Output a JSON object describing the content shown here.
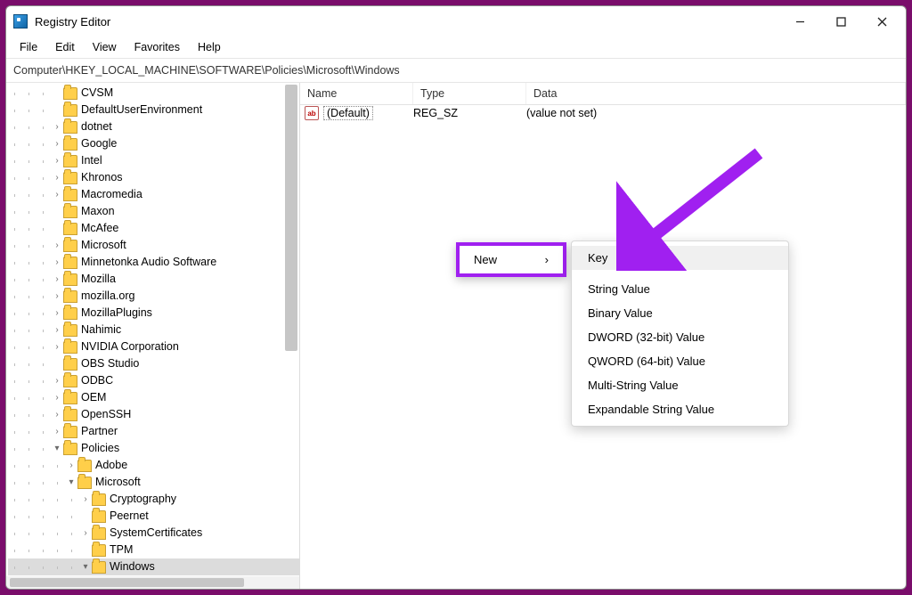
{
  "window": {
    "title": "Registry Editor"
  },
  "menubar": [
    "File",
    "Edit",
    "View",
    "Favorites",
    "Help"
  ],
  "address": "Computer\\HKEY_LOCAL_MACHINE\\SOFTWARE\\Policies\\Microsoft\\Windows",
  "tree": [
    {
      "indent": 3,
      "chev": "",
      "label": "CVSM"
    },
    {
      "indent": 3,
      "chev": "",
      "label": "DefaultUserEnvironment"
    },
    {
      "indent": 3,
      "chev": ">",
      "label": "dotnet"
    },
    {
      "indent": 3,
      "chev": ">",
      "label": "Google"
    },
    {
      "indent": 3,
      "chev": ">",
      "label": "Intel"
    },
    {
      "indent": 3,
      "chev": ">",
      "label": "Khronos"
    },
    {
      "indent": 3,
      "chev": ">",
      "label": "Macromedia"
    },
    {
      "indent": 3,
      "chev": "",
      "label": "Maxon"
    },
    {
      "indent": 3,
      "chev": "",
      "label": "McAfee"
    },
    {
      "indent": 3,
      "chev": ">",
      "label": "Microsoft"
    },
    {
      "indent": 3,
      "chev": ">",
      "label": "Minnetonka Audio Software"
    },
    {
      "indent": 3,
      "chev": ">",
      "label": "Mozilla"
    },
    {
      "indent": 3,
      "chev": ">",
      "label": "mozilla.org"
    },
    {
      "indent": 3,
      "chev": ">",
      "label": "MozillaPlugins"
    },
    {
      "indent": 3,
      "chev": ">",
      "label": "Nahimic"
    },
    {
      "indent": 3,
      "chev": ">",
      "label": "NVIDIA Corporation"
    },
    {
      "indent": 3,
      "chev": "",
      "label": "OBS Studio"
    },
    {
      "indent": 3,
      "chev": ">",
      "label": "ODBC"
    },
    {
      "indent": 3,
      "chev": ">",
      "label": "OEM"
    },
    {
      "indent": 3,
      "chev": ">",
      "label": "OpenSSH"
    },
    {
      "indent": 3,
      "chev": ">",
      "label": "Partner"
    },
    {
      "indent": 3,
      "chev": "v",
      "label": "Policies"
    },
    {
      "indent": 4,
      "chev": ">",
      "label": "Adobe"
    },
    {
      "indent": 4,
      "chev": "v",
      "label": "Microsoft"
    },
    {
      "indent": 5,
      "chev": ">",
      "label": "Cryptography"
    },
    {
      "indent": 5,
      "chev": "",
      "label": "Peernet"
    },
    {
      "indent": 5,
      "chev": ">",
      "label": "SystemCertificates"
    },
    {
      "indent": 5,
      "chev": "",
      "label": "TPM"
    },
    {
      "indent": 5,
      "chev": "v",
      "label": "Windows",
      "selected": true
    }
  ],
  "columns": {
    "name": "Name",
    "type": "Type",
    "data": "Data"
  },
  "values": [
    {
      "name": "(Default)",
      "type": "REG_SZ",
      "data": "(value not set)"
    }
  ],
  "context_new": {
    "label": "New",
    "sub": [
      "Key",
      "String Value",
      "Binary Value",
      "DWORD (32-bit) Value",
      "QWORD (64-bit) Value",
      "Multi-String Value",
      "Expandable String Value"
    ]
  },
  "accent_color": "#a020f0"
}
